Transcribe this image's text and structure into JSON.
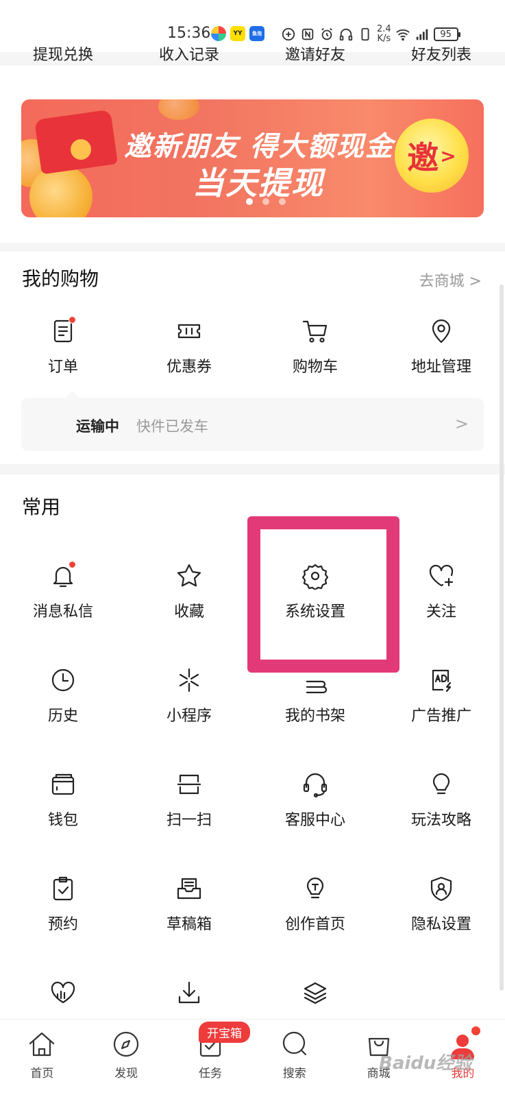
{
  "status_bar": {
    "time": "15:36",
    "apps": [
      "YY",
      "鱼泡"
    ],
    "speed_value": "2.4",
    "speed_unit": "K/s",
    "battery": "95"
  },
  "top_links": [
    "提现兑换",
    "收入记录",
    "邀请好友",
    "好友列表"
  ],
  "banner": {
    "line1": "邀新朋友 得大额现金",
    "line2": "当天提现",
    "invite_label": "邀",
    "arrow": ">"
  },
  "shopping": {
    "title": "我的购物",
    "go_mall": "去商城 >",
    "items": [
      {
        "label": "订单",
        "icon": "order-icon"
      },
      {
        "label": "优惠券",
        "icon": "coupon-icon"
      },
      {
        "label": "购物车",
        "icon": "cart-icon"
      },
      {
        "label": "地址管理",
        "icon": "location-icon"
      }
    ],
    "shipping": {
      "status": "运输中",
      "desc": "快件已发车",
      "arrow": ">"
    }
  },
  "common": {
    "title": "常用",
    "rows": [
      [
        {
          "label": "消息私信",
          "icon": "bell-icon"
        },
        {
          "label": "收藏",
          "icon": "star-icon"
        },
        {
          "label": "系统设置",
          "icon": "gear-icon"
        },
        {
          "label": "关注",
          "icon": "heart-plus-icon"
        }
      ],
      [
        {
          "label": "历史",
          "icon": "clock-icon"
        },
        {
          "label": "小程序",
          "icon": "miniprogram-icon"
        },
        {
          "label": "我的书架",
          "icon": "books-icon"
        },
        {
          "label": "广告推广",
          "icon": "ad-icon"
        }
      ],
      [
        {
          "label": "钱包",
          "icon": "wallet-icon"
        },
        {
          "label": "扫一扫",
          "icon": "scan-icon"
        },
        {
          "label": "客服中心",
          "icon": "headset-icon"
        },
        {
          "label": "玩法攻略",
          "icon": "bulb-icon"
        }
      ],
      [
        {
          "label": "预约",
          "icon": "clipboard-check-icon"
        },
        {
          "label": "草稿箱",
          "icon": "draft-icon"
        },
        {
          "label": "创作首页",
          "icon": "creator-icon"
        },
        {
          "label": "隐私设置",
          "icon": "privacy-shield-icon"
        }
      ],
      [
        {
          "label": "",
          "icon": "heart-chart-icon"
        },
        {
          "label": "",
          "icon": "download-icon"
        },
        {
          "label": "",
          "icon": "layers-icon"
        }
      ]
    ]
  },
  "bottom_nav": [
    {
      "label": "首页",
      "icon": "home-icon"
    },
    {
      "label": "发现",
      "icon": "compass-icon"
    },
    {
      "label": "任务",
      "icon": "task-icon"
    },
    {
      "label": "搜索",
      "icon": "search-icon"
    },
    {
      "label": "商城",
      "icon": "shopping-bag-icon"
    },
    {
      "label": "我的",
      "icon": "me-icon"
    }
  ],
  "task_badge": "开宝箱",
  "watermark": "Baidu经验",
  "colors": {
    "accent": "#e83a3a",
    "highlight": "#e23a78",
    "banner": "#f46a5a"
  }
}
